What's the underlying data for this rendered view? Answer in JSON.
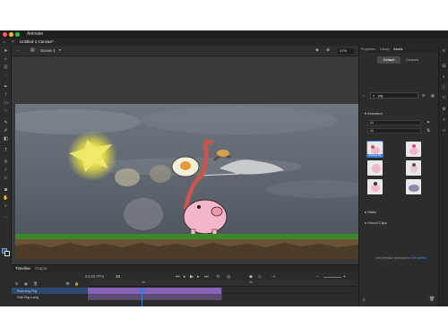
{
  "app": {
    "title": "Animate",
    "document_tab": "Untitled-1 Canvas*"
  },
  "stage_toolbar": {
    "scene": "Scene 1",
    "zoom": "37%"
  },
  "right_panel": {
    "tabs": [
      "Properties",
      "Library",
      "Assets"
    ],
    "segments": {
      "default": "Default",
      "custom": "Custom"
    },
    "search_value": "pig",
    "animated_header": "Animated",
    "dropdown_1": "All",
    "dropdown_2": "All",
    "static_header": "Static",
    "sound_clips_header": "Sound Clips",
    "asset_caption": "Running Pig",
    "footer_text": "Get premium Animations",
    "footer_link": "Get started"
  },
  "timeline": {
    "tabs": {
      "timeline": "Timeline",
      "output": "Output"
    },
    "fps": "24.00 FPS",
    "current_frame": "19",
    "layers": [
      {
        "name": "Running Pig"
      },
      {
        "name": "Stat Big Lang"
      }
    ],
    "ruler_marks": [
      "1s",
      "2s"
    ]
  },
  "colors": {
    "accent": "#3b7ad6",
    "frames_purple": "#8862b8",
    "stroke_swatch": "#1a56c8"
  }
}
